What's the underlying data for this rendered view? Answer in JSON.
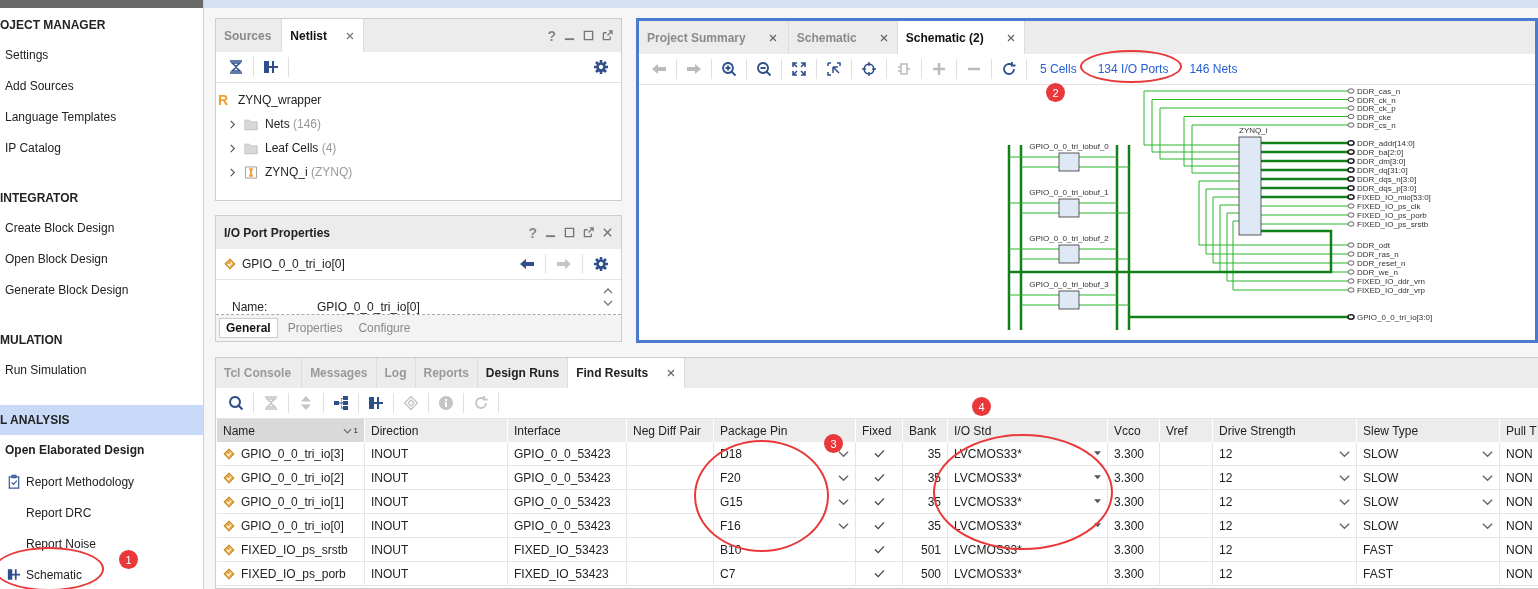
{
  "sidebar": {
    "sections": [
      {
        "title": "OJECT MANAGER",
        "selected": false,
        "items": [
          {
            "label": "Settings"
          },
          {
            "label": "Add Sources"
          },
          {
            "label": "Language Templates"
          },
          {
            "label": "IP Catalog"
          }
        ]
      },
      {
        "title": "INTEGRATOR",
        "selected": false,
        "items": [
          {
            "label": "Create Block Design"
          },
          {
            "label": "Open Block Design"
          },
          {
            "label": "Generate Block Design"
          }
        ]
      },
      {
        "title": "MULATION",
        "selected": false,
        "items": [
          {
            "label": "Run Simulation"
          }
        ]
      },
      {
        "title": "L ANALYSIS",
        "selected": true,
        "items": [
          {
            "label": "Open Elaborated Design",
            "children": [
              {
                "label": "Report Methodology",
                "kind": "checklist"
              },
              {
                "label": "Report DRC",
                "kind": "plain"
              },
              {
                "label": "Report Noise",
                "kind": "plain"
              },
              {
                "label": "Schematic",
                "kind": "schematic"
              }
            ]
          }
        ]
      }
    ]
  },
  "netlist_panel": {
    "help": "?",
    "tabs": [
      {
        "label": "Sources",
        "selected": false,
        "closable": false
      },
      {
        "label": "Netlist",
        "selected": true,
        "closable": true
      }
    ],
    "toolbar": [
      {
        "kind": "collapse-all",
        "disabled": false
      },
      {
        "kind": "schematic",
        "disabled": false
      }
    ],
    "tree": {
      "badge": "R",
      "label": "ZYNQ_wrapper",
      "children": [
        {
          "label": "Nets",
          "count": "(146)",
          "kind": "folder",
          "expanded": false
        },
        {
          "label": "Leaf Cells",
          "count": "(4)",
          "kind": "folder",
          "expanded": false
        },
        {
          "label": "ZYNQ_i",
          "count": "(ZYNQ)",
          "kind": "cell",
          "expanded": false
        }
      ]
    }
  },
  "properties_panel": {
    "title": "I/O Port Properties",
    "help": "?",
    "object": "GPIO_0_0_tri_io[0]",
    "toolbar": [
      {
        "kind": "back",
        "disabled": false
      },
      {
        "kind": "forward",
        "disabled": true
      }
    ],
    "field": {
      "label": "Name:",
      "value": "GPIO_0_0_tri_io[0]"
    },
    "tabs": [
      {
        "label": "General",
        "selected": true
      },
      {
        "label": "Properties",
        "selected": false
      },
      {
        "label": "Configure",
        "selected": false
      }
    ]
  },
  "schematic_panel": {
    "tabs": [
      {
        "label": "Project Summary",
        "selected": false
      },
      {
        "label": "Schematic",
        "selected": false
      },
      {
        "label": "Schematic (2)",
        "selected": true
      }
    ],
    "toolbar": [
      {
        "kind": "back",
        "disabled": true
      },
      {
        "kind": "forward",
        "disabled": true
      },
      {
        "kind": "zoom-in",
        "disabled": false
      },
      {
        "kind": "zoom-out",
        "disabled": false
      },
      {
        "kind": "fit",
        "disabled": false
      },
      {
        "kind": "zoom-area",
        "disabled": false
      },
      {
        "kind": "center",
        "disabled": false
      },
      {
        "kind": "collapse",
        "disabled": true
      },
      {
        "kind": "plus",
        "disabled": true
      },
      {
        "kind": "minus",
        "disabled": true
      },
      {
        "kind": "refresh",
        "disabled": false
      }
    ],
    "links": [
      {
        "label": "5 Cells"
      },
      {
        "label": "134 I/O Ports"
      },
      {
        "label": "146 Nets"
      }
    ],
    "schematic": {
      "cells": [
        {
          "label": "ZYNQ_i",
          "kind": "zynq"
        },
        {
          "label": "GPIO_0_0_tri_iobuf_0",
          "kind": "iobuf"
        },
        {
          "label": "GPIO_0_0_tri_iobuf_1",
          "kind": "iobuf"
        },
        {
          "label": "GPIO_0_0_tri_iobuf_2",
          "kind": "iobuf"
        },
        {
          "label": "GPIO_0_0_tri_iobuf_3",
          "kind": "iobuf"
        }
      ],
      "ports": [
        {
          "label": "DDR_cas_n",
          "bus": false
        },
        {
          "label": "DDR_ck_n",
          "bus": false
        },
        {
          "label": "DDR_ck_p",
          "bus": false
        },
        {
          "label": "DDR_cke",
          "bus": false
        },
        {
          "label": "DDR_cs_n",
          "bus": false
        },
        {
          "label": "DDR_addr[14:0]",
          "bus": true
        },
        {
          "label": "DDR_ba[2:0]",
          "bus": true
        },
        {
          "label": "DDR_dm[3:0]",
          "bus": true
        },
        {
          "label": "DDR_dq[31:0]",
          "bus": true
        },
        {
          "label": "DDR_dqs_n[3:0]",
          "bus": true
        },
        {
          "label": "DDR_dqs_p[3:0]",
          "bus": true
        },
        {
          "label": "FIXED_IO_mio[53:0]",
          "bus": true
        },
        {
          "label": "FIXED_IO_ps_clk",
          "bus": false
        },
        {
          "label": "FIXED_IO_ps_porb",
          "bus": false
        },
        {
          "label": "FIXED_IO_ps_srstb",
          "bus": false
        },
        {
          "label": "DDR_odt",
          "bus": false
        },
        {
          "label": "DDR_ras_n",
          "bus": false
        },
        {
          "label": "DDR_reset_n",
          "bus": false
        },
        {
          "label": "DDR_we_n",
          "bus": false
        },
        {
          "label": "FIXED_IO_ddr_vrn",
          "bus": false
        },
        {
          "label": "FIXED_IO_ddr_vrp",
          "bus": false
        },
        {
          "label": "GPIO_0_0_tri_io[3:0]",
          "bus": true
        }
      ]
    }
  },
  "results_panel": {
    "tabs": [
      {
        "label": "Tcl Console",
        "selected": false,
        "highlighted": false
      },
      {
        "label": "Messages",
        "selected": false,
        "highlighted": false
      },
      {
        "label": "Log",
        "selected": false,
        "highlighted": false
      },
      {
        "label": "Reports",
        "selected": false,
        "highlighted": false
      },
      {
        "label": "Design Runs",
        "selected": false,
        "highlighted": true
      },
      {
        "label": "Find Results",
        "selected": true,
        "highlighted": true
      }
    ],
    "toolbar": [
      {
        "kind": "search",
        "disabled": false
      },
      {
        "kind": "collapse-all",
        "disabled": true
      },
      {
        "kind": "expand-all",
        "disabled": true
      },
      {
        "kind": "hierarchy",
        "disabled": false
      },
      {
        "kind": "schematic",
        "disabled": false
      },
      {
        "kind": "diamond",
        "disabled": true
      },
      {
        "kind": "info",
        "disabled": true
      },
      {
        "kind": "refresh",
        "disabled": true
      }
    ],
    "table": {
      "sort_rank": "1",
      "columns": [
        {
          "label": "Name"
        },
        {
          "label": "Direction"
        },
        {
          "label": "Interface"
        },
        {
          "label": "Neg Diff Pair"
        },
        {
          "label": "Package Pin"
        },
        {
          "label": "Fixed"
        },
        {
          "label": "Bank"
        },
        {
          "label": "I/O Std"
        },
        {
          "label": "Vcco"
        },
        {
          "label": "Vref"
        },
        {
          "label": "Drive Strength"
        },
        {
          "label": "Slew Type"
        },
        {
          "label": "Pull T"
        }
      ],
      "rows": [
        {
          "name": "GPIO_0_0_tri_io[3]",
          "direction": "INOUT",
          "interface": "GPIO_0_0_53423",
          "package_pin": "D18",
          "fixed": true,
          "bank": "35",
          "io_std": "LVCMOS33*",
          "vcco": "3.300",
          "drive_strength": "12",
          "slew_type": "SLOW",
          "pull_type": "NON",
          "editable": true
        },
        {
          "name": "GPIO_0_0_tri_io[2]",
          "direction": "INOUT",
          "interface": "GPIO_0_0_53423",
          "package_pin": "F20",
          "fixed": true,
          "bank": "35",
          "io_std": "LVCMOS33*",
          "vcco": "3.300",
          "drive_strength": "12",
          "slew_type": "SLOW",
          "pull_type": "NON",
          "editable": true
        },
        {
          "name": "GPIO_0_0_tri_io[1]",
          "direction": "INOUT",
          "interface": "GPIO_0_0_53423",
          "package_pin": "G15",
          "fixed": true,
          "bank": "35",
          "io_std": "LVCMOS33*",
          "vcco": "3.300",
          "drive_strength": "12",
          "slew_type": "SLOW",
          "pull_type": "NON",
          "editable": true
        },
        {
          "name": "GPIO_0_0_tri_io[0]",
          "direction": "INOUT",
          "interface": "GPIO_0_0_53423",
          "package_pin": "F16",
          "fixed": true,
          "bank": "35",
          "io_std": "LVCMOS33*",
          "vcco": "3.300",
          "drive_strength": "12",
          "slew_type": "SLOW",
          "pull_type": "NON",
          "editable": true
        },
        {
          "name": "FIXED_IO_ps_srstb",
          "direction": "INOUT",
          "interface": "FIXED_IO_53423",
          "package_pin": "B10",
          "fixed": true,
          "bank": "501",
          "io_std": "LVCMOS33*",
          "vcco": "3.300",
          "drive_strength": "12",
          "slew_type": "FAST",
          "pull_type": "NON",
          "editable": false
        },
        {
          "name": "FIXED_IO_ps_porb",
          "direction": "INOUT",
          "interface": "FIXED_IO_53423",
          "package_pin": "C7",
          "fixed": true,
          "bank": "500",
          "io_std": "LVCMOS33*",
          "vcco": "3.300",
          "drive_strength": "12",
          "slew_type": "FAST",
          "pull_type": "NON",
          "editable": false
        }
      ]
    }
  },
  "annotations": [
    {
      "number": "1"
    },
    {
      "number": "2"
    },
    {
      "number": "3"
    },
    {
      "number": "4"
    }
  ]
}
